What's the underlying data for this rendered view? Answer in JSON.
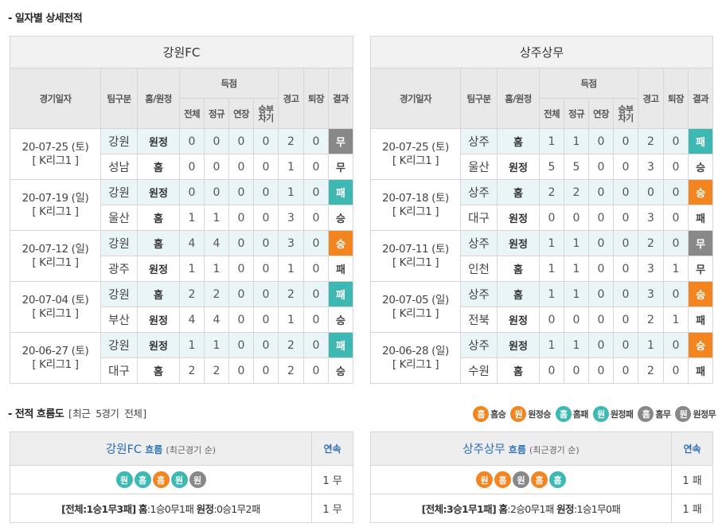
{
  "section1": {
    "title": "- 일자별 상세전적"
  },
  "headers": {
    "date": "경기일자",
    "team": "팀구분",
    "homeaway": "홈/원정",
    "score": "득점",
    "total": "전체",
    "regular": "정규",
    "extra": "연장",
    "penalty_line1": "승부",
    "penalty_line2": "차기",
    "warning": "경고",
    "sendoff": "퇴장",
    "result": "결과"
  },
  "teamA": {
    "name": "강원FC",
    "games": [
      {
        "date": "20-07-25 (토)",
        "league": "[ K리그1 ]",
        "rows": [
          {
            "team": "강원",
            "ha": "원정",
            "total": "0",
            "regular": "0",
            "extra": "0",
            "pk": "0",
            "warn": "2",
            "off": "0",
            "res": "무",
            "resType": "draw"
          },
          {
            "team": "성남",
            "ha": "홈",
            "total": "0",
            "regular": "0",
            "extra": "0",
            "pk": "0",
            "warn": "1",
            "off": "0",
            "res": "무",
            "resType": ""
          }
        ]
      },
      {
        "date": "20-07-19 (일)",
        "league": "[ K리그1 ]",
        "rows": [
          {
            "team": "강원",
            "ha": "원정",
            "total": "0",
            "regular": "0",
            "extra": "0",
            "pk": "0",
            "warn": "1",
            "off": "0",
            "res": "패",
            "resType": "lose"
          },
          {
            "team": "울산",
            "ha": "홈",
            "total": "1",
            "regular": "1",
            "extra": "0",
            "pk": "0",
            "warn": "3",
            "off": "0",
            "res": "승",
            "resType": ""
          }
        ]
      },
      {
        "date": "20-07-12 (일)",
        "league": "[ K리그1 ]",
        "rows": [
          {
            "team": "강원",
            "ha": "홈",
            "total": "4",
            "regular": "4",
            "extra": "0",
            "pk": "0",
            "warn": "3",
            "off": "0",
            "res": "승",
            "resType": "win"
          },
          {
            "team": "광주",
            "ha": "원정",
            "total": "1",
            "regular": "1",
            "extra": "0",
            "pk": "0",
            "warn": "1",
            "off": "0",
            "res": "패",
            "resType": ""
          }
        ]
      },
      {
        "date": "20-07-04 (토)",
        "league": "[ K리그1 ]",
        "rows": [
          {
            "team": "강원",
            "ha": "홈",
            "total": "2",
            "regular": "2",
            "extra": "0",
            "pk": "0",
            "warn": "2",
            "off": "0",
            "res": "패",
            "resType": "lose"
          },
          {
            "team": "부산",
            "ha": "원정",
            "total": "4",
            "regular": "4",
            "extra": "0",
            "pk": "0",
            "warn": "1",
            "off": "0",
            "res": "승",
            "resType": ""
          }
        ]
      },
      {
        "date": "20-06-27 (토)",
        "league": "[ K리그1 ]",
        "rows": [
          {
            "team": "강원",
            "ha": "원정",
            "total": "1",
            "regular": "1",
            "extra": "0",
            "pk": "0",
            "warn": "2",
            "off": "0",
            "res": "패",
            "resType": "lose"
          },
          {
            "team": "대구",
            "ha": "홈",
            "total": "2",
            "regular": "2",
            "extra": "0",
            "pk": "0",
            "warn": "2",
            "off": "0",
            "res": "승",
            "resType": ""
          }
        ]
      }
    ]
  },
  "teamB": {
    "name": "상주상무",
    "games": [
      {
        "date": "20-07-25 (토)",
        "league": "[ K리그1 ]",
        "rows": [
          {
            "team": "상주",
            "ha": "홈",
            "total": "1",
            "regular": "1",
            "extra": "0",
            "pk": "0",
            "warn": "2",
            "off": "0",
            "res": "패",
            "resType": "lose"
          },
          {
            "team": "울산",
            "ha": "원정",
            "total": "5",
            "regular": "5",
            "extra": "0",
            "pk": "0",
            "warn": "3",
            "off": "0",
            "res": "승",
            "resType": ""
          }
        ]
      },
      {
        "date": "20-07-18 (토)",
        "league": "[ K리그1 ]",
        "rows": [
          {
            "team": "상주",
            "ha": "홈",
            "total": "2",
            "regular": "2",
            "extra": "0",
            "pk": "0",
            "warn": "0",
            "off": "0",
            "res": "승",
            "resType": "win"
          },
          {
            "team": "대구",
            "ha": "원정",
            "total": "0",
            "regular": "0",
            "extra": "0",
            "pk": "0",
            "warn": "3",
            "off": "0",
            "res": "패",
            "resType": ""
          }
        ]
      },
      {
        "date": "20-07-11 (토)",
        "league": "[ K리그1 ]",
        "rows": [
          {
            "team": "상주",
            "ha": "원정",
            "total": "1",
            "regular": "1",
            "extra": "0",
            "pk": "0",
            "warn": "2",
            "off": "0",
            "res": "무",
            "resType": "draw"
          },
          {
            "team": "인천",
            "ha": "홈",
            "total": "1",
            "regular": "1",
            "extra": "0",
            "pk": "0",
            "warn": "3",
            "off": "1",
            "res": "무",
            "resType": ""
          }
        ]
      },
      {
        "date": "20-07-05 (일)",
        "league": "[ K리그1 ]",
        "rows": [
          {
            "team": "상주",
            "ha": "홈",
            "total": "1",
            "regular": "1",
            "extra": "0",
            "pk": "0",
            "warn": "3",
            "off": "0",
            "res": "승",
            "resType": "win"
          },
          {
            "team": "전북",
            "ha": "원정",
            "total": "0",
            "regular": "0",
            "extra": "0",
            "pk": "0",
            "warn": "2",
            "off": "1",
            "res": "패",
            "resType": ""
          }
        ]
      },
      {
        "date": "20-06-28 (일)",
        "league": "[ K리그1 ]",
        "rows": [
          {
            "team": "상주",
            "ha": "원정",
            "total": "1",
            "regular": "1",
            "extra": "0",
            "pk": "0",
            "warn": "1",
            "off": "0",
            "res": "승",
            "resType": "win"
          },
          {
            "team": "수원",
            "ha": "홈",
            "total": "0",
            "regular": "0",
            "extra": "0",
            "pk": "0",
            "warn": "2",
            "off": "0",
            "res": "패",
            "resType": ""
          }
        ]
      }
    ]
  },
  "section2": {
    "title": "- 전적 흐름도",
    "subtitle": "[최근 5경기 전체]"
  },
  "legend": [
    {
      "glyph": "홈",
      "label": "홈승",
      "cls": "c-homewin"
    },
    {
      "glyph": "원",
      "label": "원정승",
      "cls": "c-awaywin"
    },
    {
      "glyph": "홈",
      "label": "홈패",
      "cls": "c-homelose"
    },
    {
      "glyph": "원",
      "label": "원정패",
      "cls": "c-awaylose"
    },
    {
      "glyph": "홈",
      "label": "홈무",
      "cls": "c-homedraw"
    },
    {
      "glyph": "원",
      "label": "원정무",
      "cls": "c-awaydraw"
    }
  ],
  "flowA": {
    "team": "강원FC",
    "label": "흐름",
    "note": "(최근경기 순)",
    "streakHeader": "연속",
    "icons": [
      {
        "glyph": "원",
        "cls": "c-awaylose"
      },
      {
        "glyph": "홈",
        "cls": "c-homelose"
      },
      {
        "glyph": "홈",
        "cls": "c-homewin"
      },
      {
        "glyph": "원",
        "cls": "c-awaylose"
      },
      {
        "glyph": "원",
        "cls": "c-awaydraw"
      }
    ],
    "streak": "1 무",
    "summary": {
      "overall": "[전체:1승1무3패]",
      "homeLabel": "홈",
      "home": ":1승0무1패",
      "awayLabel": "원정",
      "away": ":0승1무2패"
    },
    "summaryStreak": "1 무"
  },
  "flowB": {
    "team": "상주상무",
    "label": "흐름",
    "note": "(최근경기 순)",
    "streakHeader": "연속",
    "icons": [
      {
        "glyph": "원",
        "cls": "c-awaywin"
      },
      {
        "glyph": "홈",
        "cls": "c-homewin"
      },
      {
        "glyph": "원",
        "cls": "c-awaydraw"
      },
      {
        "glyph": "홈",
        "cls": "c-homewin"
      },
      {
        "glyph": "홈",
        "cls": "c-homelose"
      }
    ],
    "streak": "1 패",
    "summary": {
      "overall": "[전체:3승1무1패]",
      "homeLabel": "홈",
      "home": ":2승0무1패",
      "awayLabel": "원정",
      "away": ":1승1무0패"
    },
    "summaryStreak": "1 패"
  }
}
